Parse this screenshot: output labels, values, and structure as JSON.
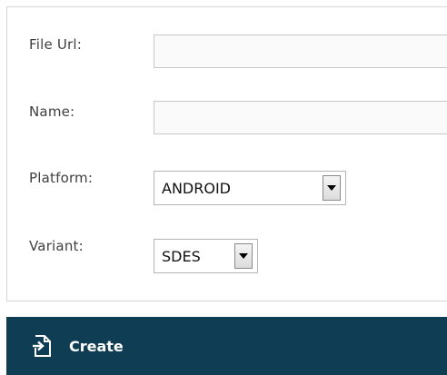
{
  "form": {
    "file_url": {
      "label": "File Url:",
      "value": "",
      "placeholder": ""
    },
    "name": {
      "label": "Name:",
      "value": "",
      "placeholder": ""
    },
    "platform": {
      "label": "Platform:",
      "selected": "ANDROID"
    },
    "variant": {
      "label": "Variant:",
      "selected": "SDES"
    }
  },
  "actions": {
    "create_label": "Create",
    "create_icon": "file-import-icon"
  },
  "colors": {
    "action_bar": "#0e3d54",
    "label_text": "#3f3f3f",
    "panel_border": "#d6d6d6"
  }
}
